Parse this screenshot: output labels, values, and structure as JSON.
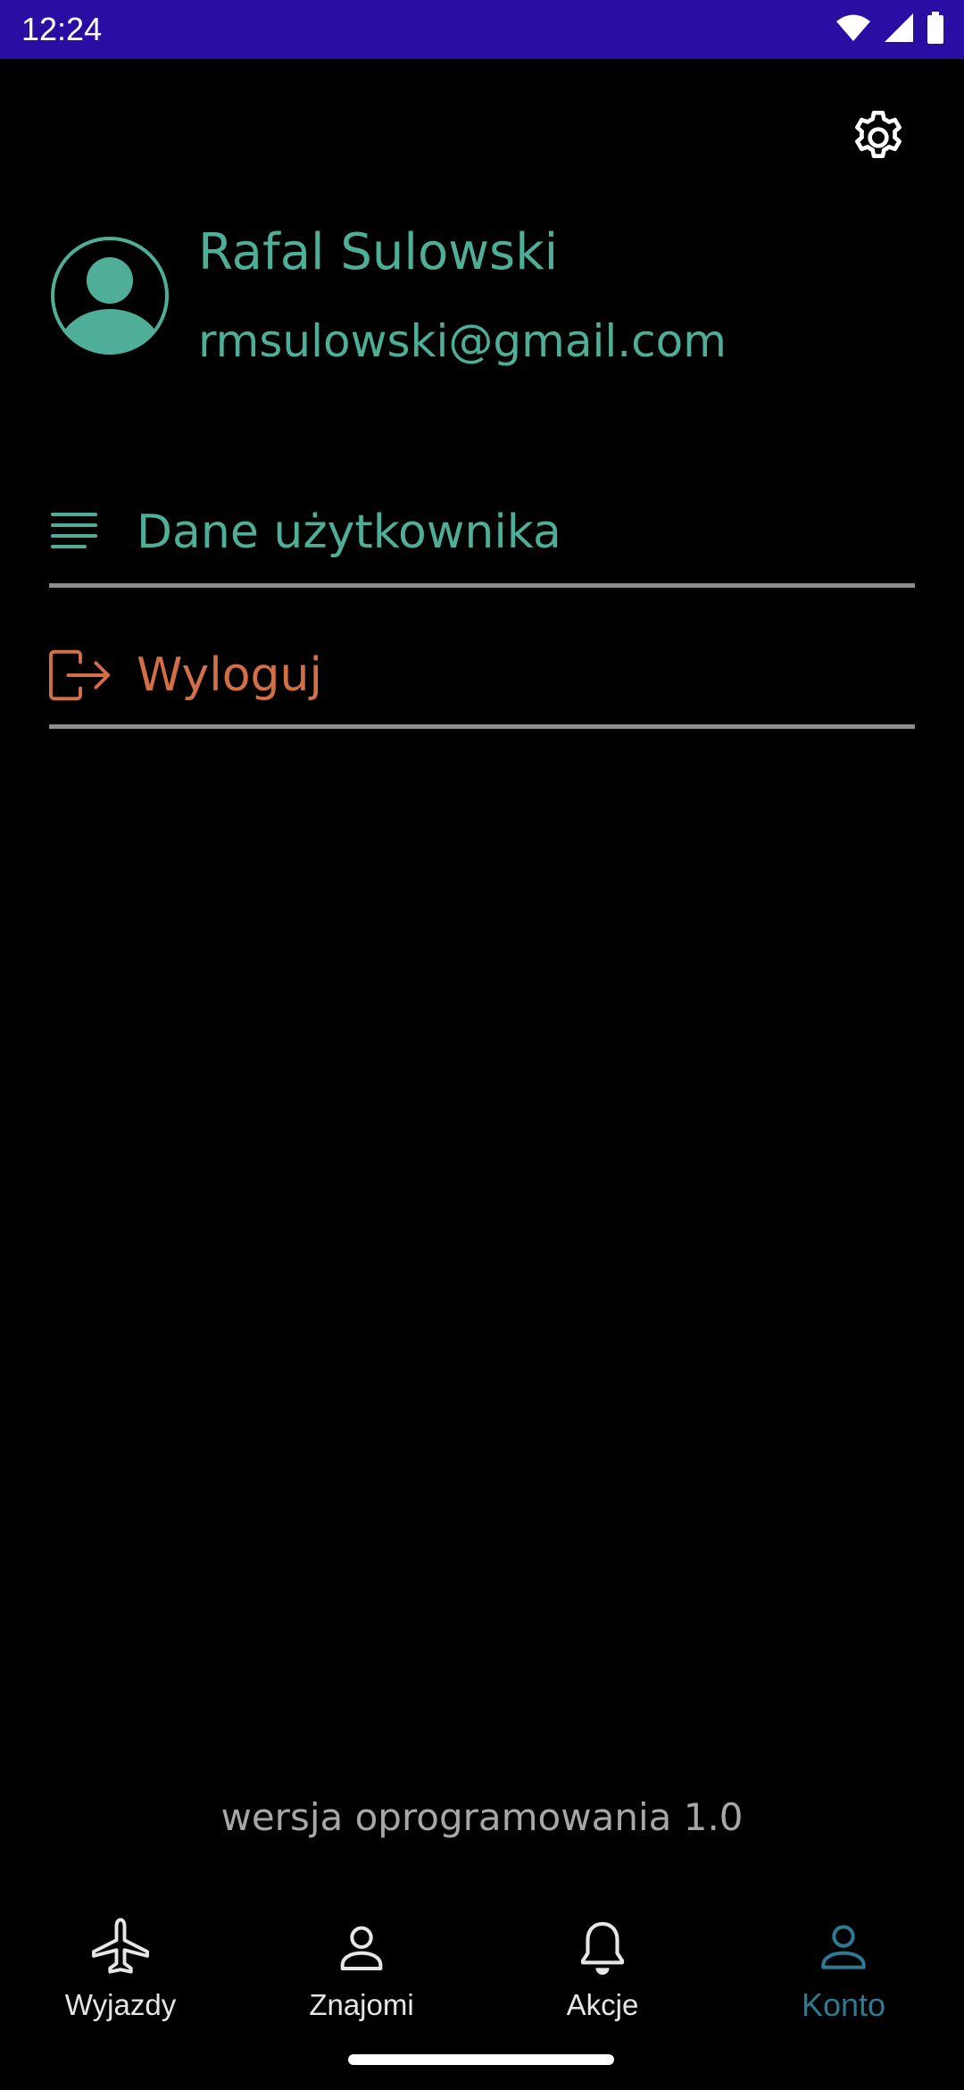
{
  "status_bar": {
    "time": "12:24",
    "icons": [
      "wifi-icon",
      "signal-icon",
      "battery-icon"
    ]
  },
  "header": {
    "settings_icon": "gear-icon"
  },
  "profile": {
    "avatar_icon": "user-avatar-icon",
    "name": "Rafal Sulowski",
    "email": "rmsulowski@gmail.com"
  },
  "menu": {
    "items": [
      {
        "icon": "list-lines-icon",
        "label": "Dane użytkownika"
      },
      {
        "icon": "logout-icon",
        "label": "Wyloguj"
      }
    ]
  },
  "footer": {
    "version": "wersja oprogramowania 1.0"
  },
  "bottom_nav": {
    "items": [
      {
        "icon": "airplane-icon",
        "label": "Wyjazdy",
        "active": false
      },
      {
        "icon": "person-icon",
        "label": "Znajomi",
        "active": false
      },
      {
        "icon": "bell-icon",
        "label": "Akcje",
        "active": false
      },
      {
        "icon": "person-icon",
        "label": "Konto",
        "active": true
      }
    ]
  },
  "colors": {
    "status_bar": "#2a0ea3",
    "background": "#000000",
    "accent_green": "#4fae97",
    "logout_orange": "#d36f47",
    "active_tab": "#2f7a92",
    "divider": "#8c8c8c",
    "muted_text": "#a7a7a7"
  }
}
